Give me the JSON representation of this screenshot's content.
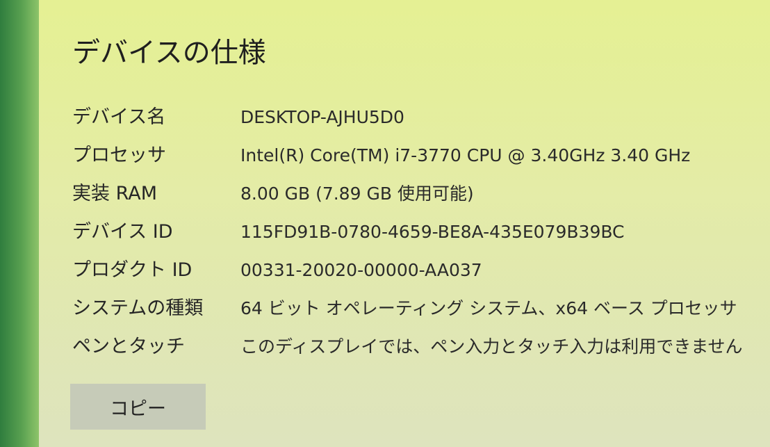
{
  "page": {
    "title": "デバイスの仕様"
  },
  "specs": [
    {
      "label": "デバイス名",
      "value": "DESKTOP-AJHU5D0"
    },
    {
      "label": "プロセッサ",
      "value": "Intel(R) Core(TM) i7-3770 CPU @ 3.40GHz   3.40 GHz"
    },
    {
      "label": "実装 RAM",
      "value": "8.00 GB (7.89 GB 使用可能)"
    },
    {
      "label": "デバイス ID",
      "value": "115FD91B-0780-4659-BE8A-435E079B39BC"
    },
    {
      "label": "プロダクト ID",
      "value": "00331-20020-00000-AA037"
    },
    {
      "label": "システムの種類",
      "value": "64 ビット オペレーティング システム、x64 ベース プロセッサ"
    },
    {
      "label": "ペンとタッチ",
      "value": "このディスプレイでは、ペン入力とタッチ入力は利用できません"
    }
  ],
  "actions": {
    "copy_label": "コピー"
  }
}
